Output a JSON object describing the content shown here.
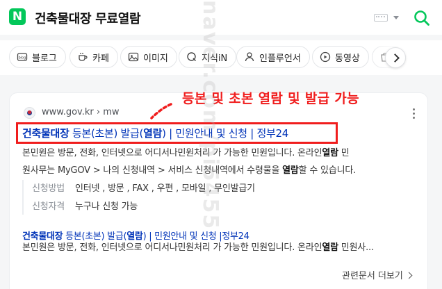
{
  "header": {
    "logo_letter": "N",
    "query": "건축물대장 무료열람"
  },
  "tabs": [
    {
      "label": "블로그",
      "icon": "blog-icon"
    },
    {
      "label": "카페",
      "icon": "cafe-icon"
    },
    {
      "label": "이미지",
      "icon": "image-icon"
    },
    {
      "label": "지식iN",
      "icon": "kin-icon"
    },
    {
      "label": "인플루언서",
      "icon": "influencer-icon"
    },
    {
      "label": "동영상",
      "icon": "video-icon"
    },
    {
      "label": "",
      "icon": "shopping-icon"
    }
  ],
  "annotation": {
    "text": "등본 및 초본 열람 및 발급 가능",
    "color": "#f01d1d"
  },
  "result1": {
    "site": "www.gov.kr › mw",
    "title_bold": "건축물대장",
    "title_p1": " 등본(초본) 발급(",
    "title_bold2": "열람",
    "title_p2": ") | 민원안내 및 신청 | 정부24",
    "desc_line1_a": "본민원은 방문, 전화, 인터넷으로 어디서나민원처리 가 가능한 민원입니다. 온라인",
    "desc_line1_bold": "열람",
    "desc_line1_b": " 민",
    "desc_line2_a": "원사무는 MyGOV > 나의 신청내역 > 서비스 신청내역에서 수령물을 ",
    "desc_line2_bold": "열람",
    "desc_line2_b": "할 수 있습니다.",
    "meta": [
      {
        "label": "신청방법",
        "value": "인터넷 , 방문 , FAX , 우편 , 모바일 , 무인발급기"
      },
      {
        "label": "신청자격",
        "value": "누구나 신청 가능"
      }
    ]
  },
  "result2": {
    "title_bold": "건축물대장",
    "title_p1": " 등본(초본) 발급(",
    "title_bold2": "열람",
    "title_p2": ") | 민원안내 및 신청 |정부24",
    "desc_a": "본민원은 방문, 전화, 인터넷으로 어디서나민원처리 가 가능한 민원입니다. 온라인",
    "desc_bold": "열람",
    "desc_b": " 민원사..."
  },
  "related_label": "관련문서 더보기",
  "watermark": "naver.com/pi5455",
  "colors": {
    "brand_green": "#03c75a",
    "link_blue": "#0033b8",
    "highlight_red": "#f01d1d"
  }
}
